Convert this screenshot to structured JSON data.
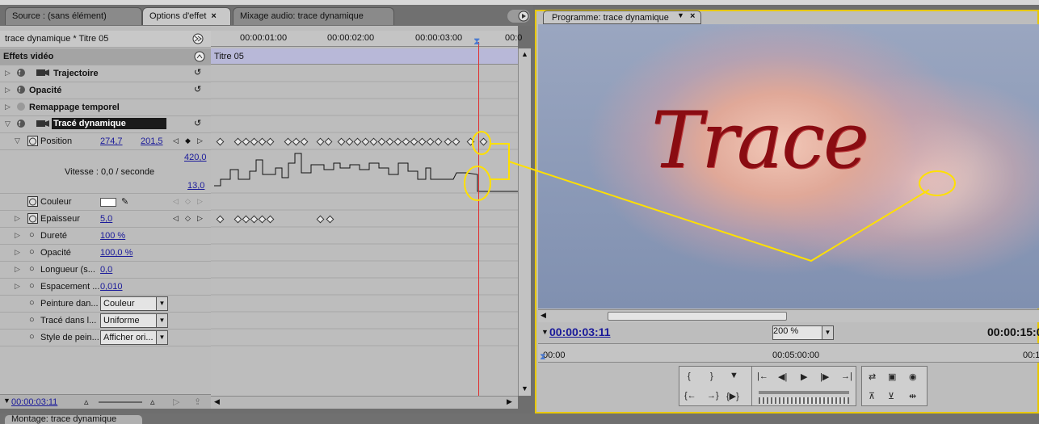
{
  "tabs": {
    "source": "Source : (sans élément)",
    "effect_options": "Options d'effet",
    "audio_mix": "Mixage audio: trace dynamique",
    "program": "Programme: trace dynamique"
  },
  "effects": {
    "clip_header": "trace dynamique * Titre 05",
    "section_title": "Effets vidéo",
    "clip_name": "Titre 05",
    "fx": [
      {
        "label": "Trajectoire"
      },
      {
        "label": "Opacité"
      },
      {
        "label": "Remappage temporel"
      },
      {
        "label": "Tracé dynamique"
      }
    ],
    "position": {
      "label": "Position",
      "x": "274,7",
      "y": "201,5"
    },
    "graph": {
      "max": "420,0",
      "min": "13,0",
      "speed": "Vitesse : 0,0 / seconde"
    },
    "color": {
      "label": "Couleur"
    },
    "thickness": {
      "label": "Epaisseur",
      "value": "5,0"
    },
    "hardness": {
      "label": "Dureté",
      "value": "100 %"
    },
    "opacity": {
      "label": "Opacité",
      "value": "100,0 %"
    },
    "length": {
      "label": "Longueur (s...",
      "value": "0,0"
    },
    "spacing": {
      "label": "Espacement ...",
      "value": "0,010"
    },
    "paint": {
      "label": "Peinture dan...",
      "value": "Couleur"
    },
    "stroke": {
      "label": "Tracé dans l...",
      "value": "Uniforme"
    },
    "style": {
      "label": "Style de pein...",
      "value": "Afficher ori..."
    },
    "current_time": "00:00:03:11"
  },
  "ruler": [
    "00:00:01:00",
    "00:00:02:00",
    "00:00:03:00",
    "00:0"
  ],
  "program": {
    "current_time": "00:00:03:11",
    "zoom": "200 %",
    "duration": "00:00:15:0",
    "ruler_start": "00:00",
    "ruler_mid": "00:05:00:00",
    "ruler_end": "00:1",
    "video_text": "Trace"
  },
  "bottom": {
    "panel": "Montage: trace dynamique"
  },
  "colors": {
    "accent_yellow": "#ffe000",
    "playhead_red": "#e03030",
    "title_red": "#8a0c12"
  }
}
